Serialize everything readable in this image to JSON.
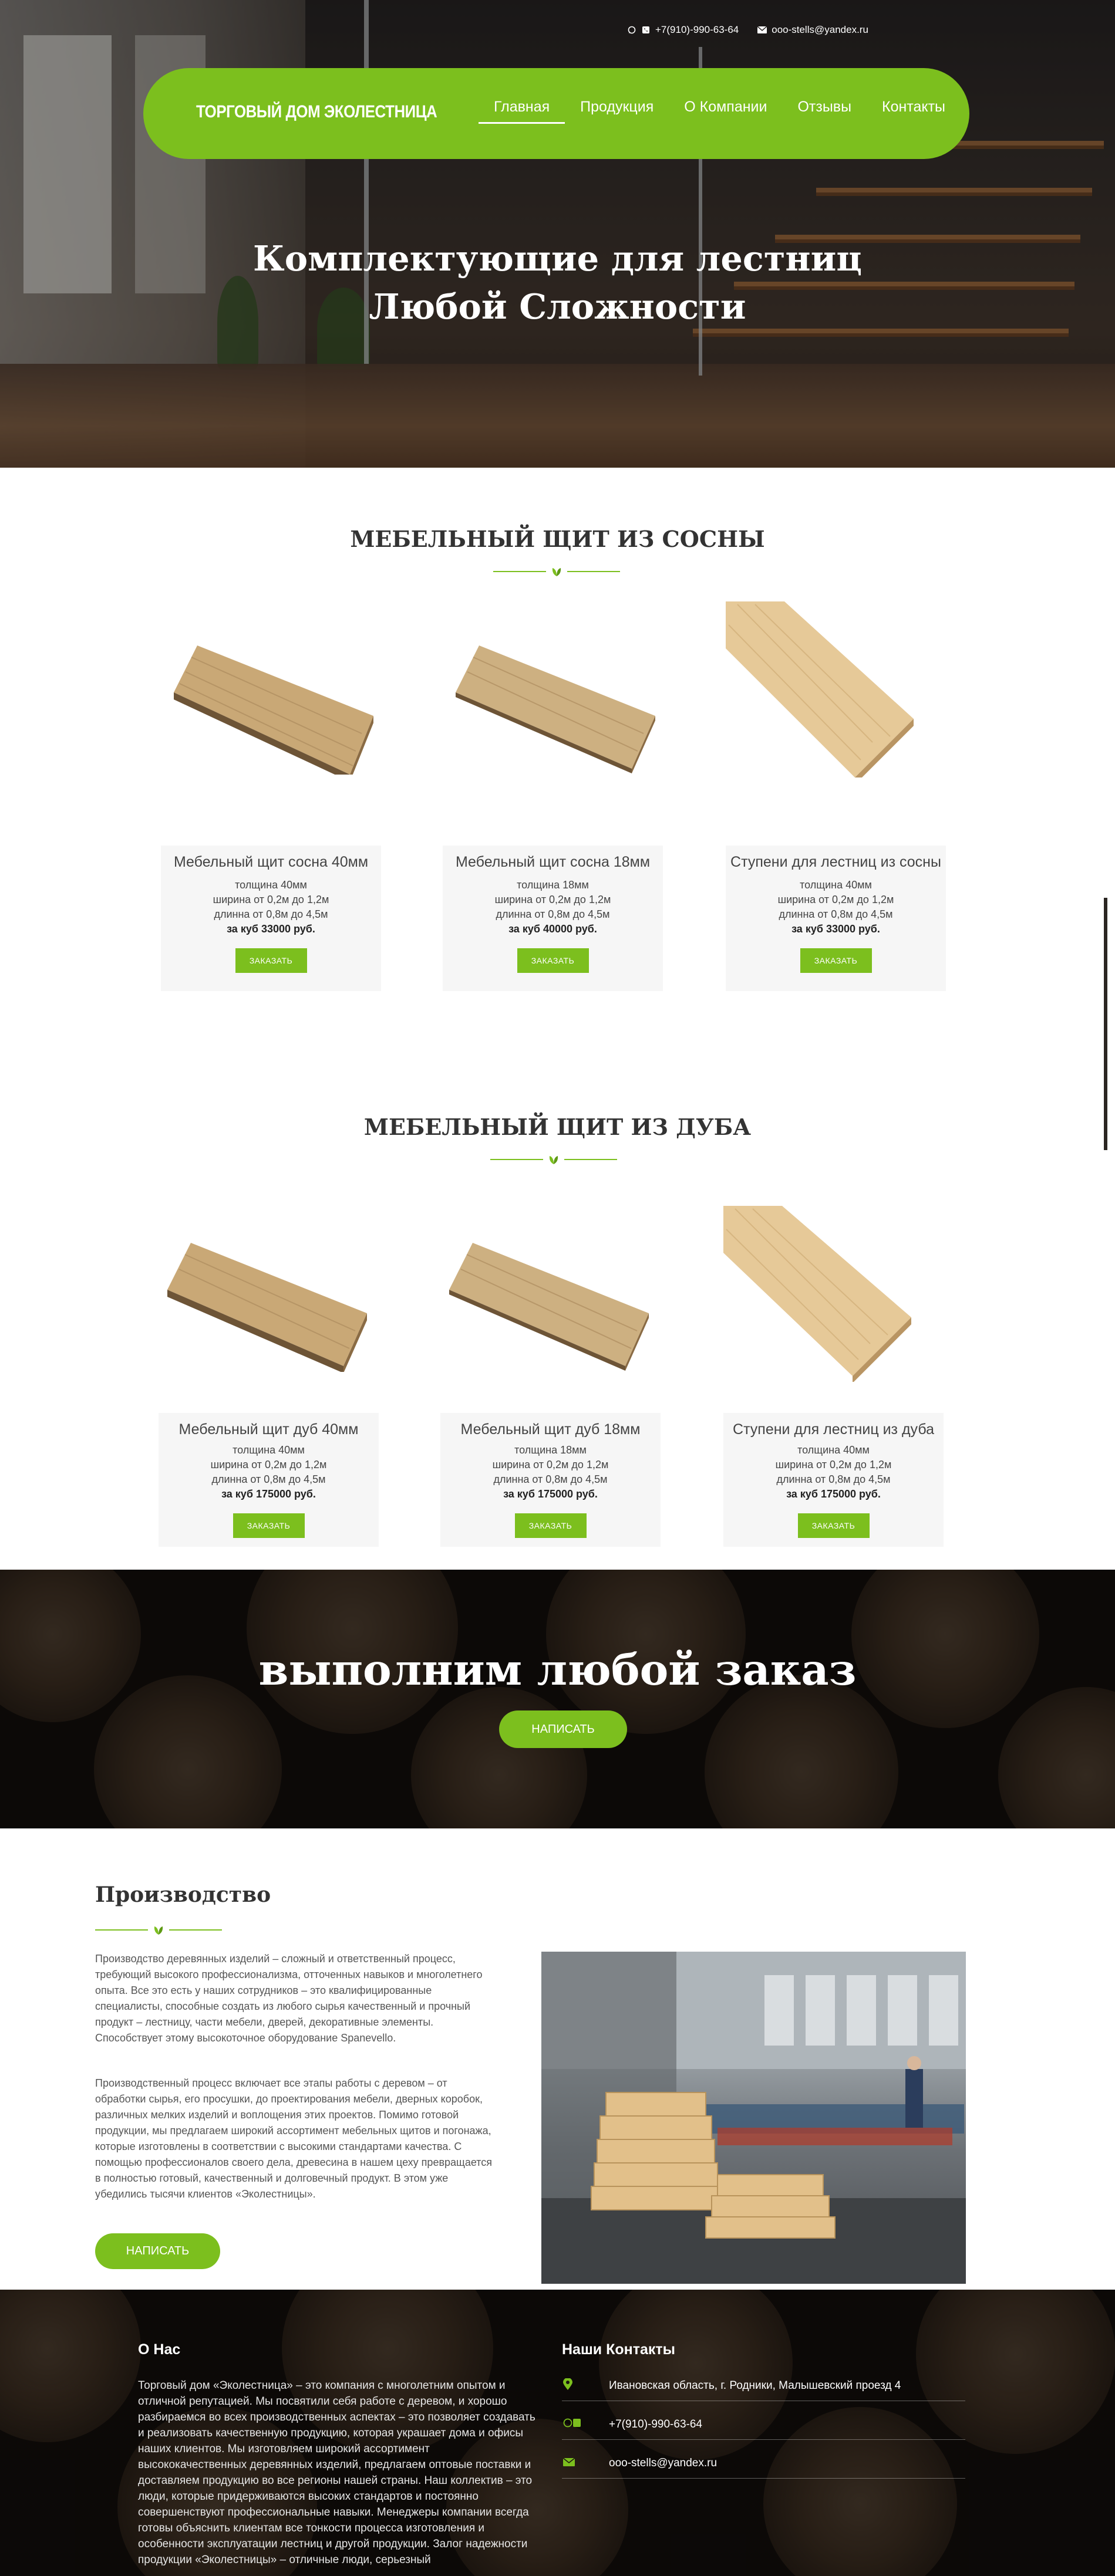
{
  "topbar": {
    "phone": "+7(910)-990-63-64",
    "email": "ooo-stells@yandex.ru",
    "phone_icons": "whatsapp-icon, phone-icon",
    "email_icon": "envelope-icon"
  },
  "header": {
    "logo": "ТОРГОВЫЙ ДОМ ЭКОЛЕСТНИЦА",
    "nav": [
      {
        "label": "Главная",
        "active": true
      },
      {
        "label": "Продукция",
        "active": false
      },
      {
        "label": "О Компании",
        "active": false
      },
      {
        "label": "Отзывы",
        "active": false
      },
      {
        "label": "Контакты",
        "active": false
      }
    ]
  },
  "hero": {
    "title_line1": "Комплектующие для лестниц",
    "title_line2": "Любой Сложности"
  },
  "pine": {
    "title": "МЕБЕЛЬНЫЙ ЩИТ ИЗ СОСНЫ",
    "products": [
      {
        "name": "Мебельный щит сосна 40мм",
        "thickness": "толщина 40мм",
        "width": "ширина от 0,2м до 1,2м",
        "length": "длинна от 0,8м до 4,5м",
        "price": "за куб 33000 руб.",
        "button": "ЗАКАЗАТЬ"
      },
      {
        "name": "Мебельный щит сосна 18мм",
        "thickness": "толщина 18мм",
        "width": "ширина от 0,2м до 1,2м",
        "length": "длинна от 0,8м до 4,5м",
        "price": "за куб 40000 руб.",
        "button": "ЗАКАЗАТЬ"
      },
      {
        "name": "Ступени для лестниц из сосны",
        "thickness": "толщина 40мм",
        "width": "ширина от 0,2м до 1,2м",
        "length": "длинна от 0,8м до 4,5м",
        "price": "за куб 33000 руб.",
        "button": "ЗАКАЗАТЬ"
      }
    ]
  },
  "oak": {
    "title": "МЕБЕЛЬНЫЙ ЩИТ ИЗ ДУБА",
    "products": [
      {
        "name": "Мебельный щит дуб 40мм",
        "thickness": "толщина 40мм",
        "width": "ширина от 0,2м до 1,2м",
        "length": "длинна от 0,8м до 4,5м",
        "price": "за куб 175000 руб.",
        "button": "ЗАКАЗАТЬ"
      },
      {
        "name": "Мебельный щит дуб 18мм",
        "thickness": "толщина 18мм",
        "width": "ширина от 0,2м до 1,2м",
        "length": "длинна от 0,8м до 4,5м",
        "price": "за куб 175000 руб.",
        "button": "ЗАКАЗАТЬ"
      },
      {
        "name": "Ступени для лестниц из дуба",
        "thickness": "толщина 40мм",
        "width": "ширина от 0,2м до 1,2м",
        "length": "длинна от 0,8м до 4,5м",
        "price": "за куб 175000 руб.",
        "button": "ЗАКАЗАТЬ"
      }
    ]
  },
  "banner": {
    "title": "выполним любой заказ",
    "button": "НАПИСАТЬ"
  },
  "production": {
    "title": "Производство",
    "paragraph1": "Производство деревянных изделий – сложный и ответственный процесс, требующий высокого профессионализма, отточенных навыков и многолетнего опыта. Все это есть у наших сотрудников – это квалифицированные специалисты, способные создать из любого сырья качественный и прочный продукт – лестницу, части мебели, дверей, декоративные элементы. Способствует этому высокоточное оборудование Spanevello.",
    "paragraph2": "Производственный процесс включает все этапы работы с деревом – от обработки сырья, его просушки, до проектирования мебели, дверных коробок, различных мелких изделий и воплощения этих проектов. Помимо готовой продукции, мы предлагаем широкий ассортимент мебельных щитов и погонажа, которые изготовлены в соответствии с высокими стандартами качества. С помощью профессионалов своего дела, древесина в нашем цеху превращается в полностью готовый, качественный и долговечный продукт. В этом уже убедились тысячи клиентов «Эколестницы».",
    "button": "НАПИСАТЬ"
  },
  "footer": {
    "about_title": "О Нас",
    "about_text": "Торговый дом «Эколестница» – это компания с многолетним опытом и отличной репутацией. Мы посвятили себя работе с деревом, и хорошо разбираемся во всех производственных аспектах – это позволяет создавать и реализовать качественную продукцию, которая украшает дома и офисы наших клиентов. Мы изготовляем широкий ассортимент высококачественных деревянных изделий, предлагаем оптовые поставки и доставляем продукцию во все регионы нашей страны. Наш коллектив – это люди, которые придерживаются высоких стандартов и постоянно совершенствуют профессиональные навыки. Менеджеры компании всегда готовы объяснить клиентам все тонкости процесса изготовления и особенности эксплуатации лестниц и другой продукции. Залог надежности продукции «Эколестницы» – отличные люди, серьезный",
    "contacts_title": "Наши Контакты",
    "address": "Ивановская область, г. Родники, Малышевский проезд 4",
    "phone": "+7(910)-990-63-64",
    "email": "ooo-stells@yandex.ru",
    "icons": [
      "map-pin-icon",
      "whatsapp-phone-icon",
      "envelope-icon"
    ]
  },
  "colors": {
    "accent": "#7cbf1e",
    "text": "#333333",
    "card_bg": "#f6f6f6"
  }
}
